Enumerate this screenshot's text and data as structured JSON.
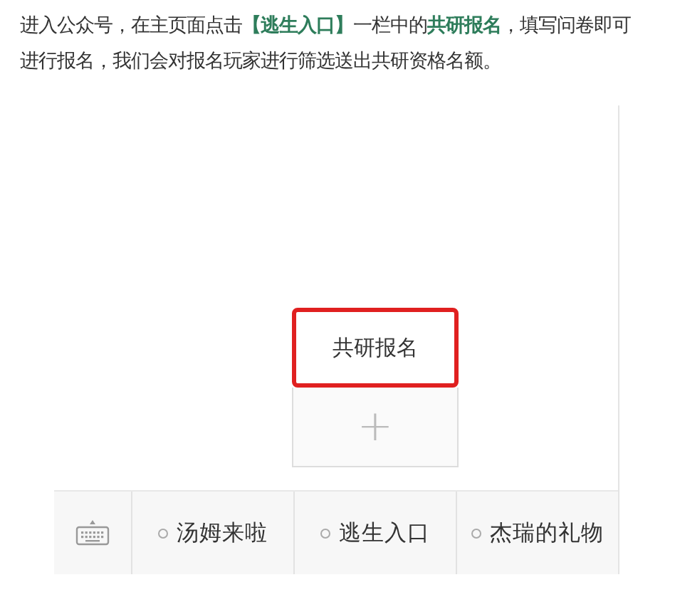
{
  "intro": "进入公众号，在主页面点击**【逃生入口】**一栏中的**共研报名**，填写问卷即可进行报名，我们会对报名玩家进行筛选送出共研资格名额。",
  "submenu": {
    "items": [
      {
        "label": "共研报名",
        "highlighted": true
      }
    ],
    "add": "+"
  },
  "menu": [
    {
      "label": "汤姆来啦"
    },
    {
      "label": "逃生入口"
    },
    {
      "label": "杰瑞的礼物"
    }
  ]
}
